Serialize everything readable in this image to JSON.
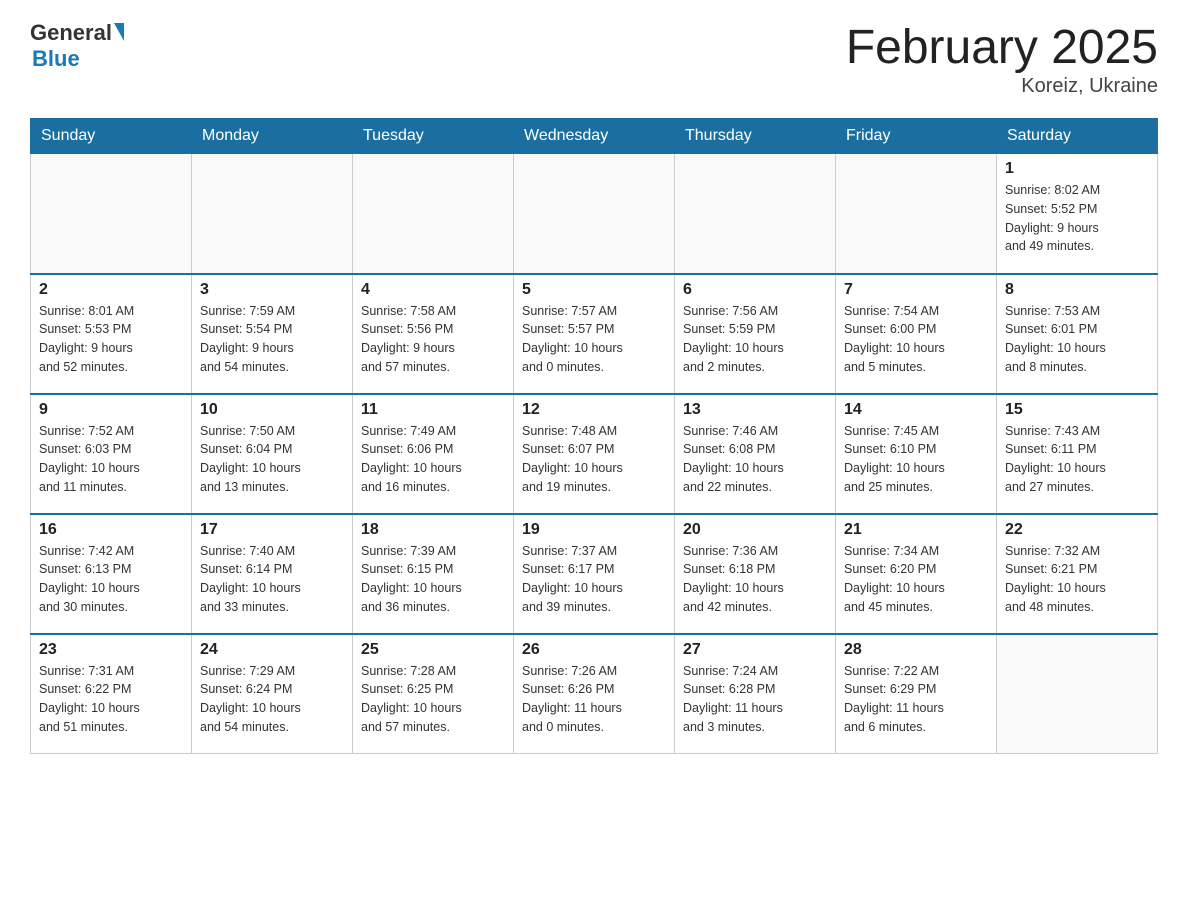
{
  "header": {
    "logo_general": "General",
    "logo_blue": "Blue",
    "title": "February 2025",
    "subtitle": "Koreiz, Ukraine"
  },
  "days_of_week": [
    "Sunday",
    "Monday",
    "Tuesday",
    "Wednesday",
    "Thursday",
    "Friday",
    "Saturday"
  ],
  "weeks": [
    [
      {
        "day": "",
        "info": ""
      },
      {
        "day": "",
        "info": ""
      },
      {
        "day": "",
        "info": ""
      },
      {
        "day": "",
        "info": ""
      },
      {
        "day": "",
        "info": ""
      },
      {
        "day": "",
        "info": ""
      },
      {
        "day": "1",
        "info": "Sunrise: 8:02 AM\nSunset: 5:52 PM\nDaylight: 9 hours\nand 49 minutes."
      }
    ],
    [
      {
        "day": "2",
        "info": "Sunrise: 8:01 AM\nSunset: 5:53 PM\nDaylight: 9 hours\nand 52 minutes."
      },
      {
        "day": "3",
        "info": "Sunrise: 7:59 AM\nSunset: 5:54 PM\nDaylight: 9 hours\nand 54 minutes."
      },
      {
        "day": "4",
        "info": "Sunrise: 7:58 AM\nSunset: 5:56 PM\nDaylight: 9 hours\nand 57 minutes."
      },
      {
        "day": "5",
        "info": "Sunrise: 7:57 AM\nSunset: 5:57 PM\nDaylight: 10 hours\nand 0 minutes."
      },
      {
        "day": "6",
        "info": "Sunrise: 7:56 AM\nSunset: 5:59 PM\nDaylight: 10 hours\nand 2 minutes."
      },
      {
        "day": "7",
        "info": "Sunrise: 7:54 AM\nSunset: 6:00 PM\nDaylight: 10 hours\nand 5 minutes."
      },
      {
        "day": "8",
        "info": "Sunrise: 7:53 AM\nSunset: 6:01 PM\nDaylight: 10 hours\nand 8 minutes."
      }
    ],
    [
      {
        "day": "9",
        "info": "Sunrise: 7:52 AM\nSunset: 6:03 PM\nDaylight: 10 hours\nand 11 minutes."
      },
      {
        "day": "10",
        "info": "Sunrise: 7:50 AM\nSunset: 6:04 PM\nDaylight: 10 hours\nand 13 minutes."
      },
      {
        "day": "11",
        "info": "Sunrise: 7:49 AM\nSunset: 6:06 PM\nDaylight: 10 hours\nand 16 minutes."
      },
      {
        "day": "12",
        "info": "Sunrise: 7:48 AM\nSunset: 6:07 PM\nDaylight: 10 hours\nand 19 minutes."
      },
      {
        "day": "13",
        "info": "Sunrise: 7:46 AM\nSunset: 6:08 PM\nDaylight: 10 hours\nand 22 minutes."
      },
      {
        "day": "14",
        "info": "Sunrise: 7:45 AM\nSunset: 6:10 PM\nDaylight: 10 hours\nand 25 minutes."
      },
      {
        "day": "15",
        "info": "Sunrise: 7:43 AM\nSunset: 6:11 PM\nDaylight: 10 hours\nand 27 minutes."
      }
    ],
    [
      {
        "day": "16",
        "info": "Sunrise: 7:42 AM\nSunset: 6:13 PM\nDaylight: 10 hours\nand 30 minutes."
      },
      {
        "day": "17",
        "info": "Sunrise: 7:40 AM\nSunset: 6:14 PM\nDaylight: 10 hours\nand 33 minutes."
      },
      {
        "day": "18",
        "info": "Sunrise: 7:39 AM\nSunset: 6:15 PM\nDaylight: 10 hours\nand 36 minutes."
      },
      {
        "day": "19",
        "info": "Sunrise: 7:37 AM\nSunset: 6:17 PM\nDaylight: 10 hours\nand 39 minutes."
      },
      {
        "day": "20",
        "info": "Sunrise: 7:36 AM\nSunset: 6:18 PM\nDaylight: 10 hours\nand 42 minutes."
      },
      {
        "day": "21",
        "info": "Sunrise: 7:34 AM\nSunset: 6:20 PM\nDaylight: 10 hours\nand 45 minutes."
      },
      {
        "day": "22",
        "info": "Sunrise: 7:32 AM\nSunset: 6:21 PM\nDaylight: 10 hours\nand 48 minutes."
      }
    ],
    [
      {
        "day": "23",
        "info": "Sunrise: 7:31 AM\nSunset: 6:22 PM\nDaylight: 10 hours\nand 51 minutes."
      },
      {
        "day": "24",
        "info": "Sunrise: 7:29 AM\nSunset: 6:24 PM\nDaylight: 10 hours\nand 54 minutes."
      },
      {
        "day": "25",
        "info": "Sunrise: 7:28 AM\nSunset: 6:25 PM\nDaylight: 10 hours\nand 57 minutes."
      },
      {
        "day": "26",
        "info": "Sunrise: 7:26 AM\nSunset: 6:26 PM\nDaylight: 11 hours\nand 0 minutes."
      },
      {
        "day": "27",
        "info": "Sunrise: 7:24 AM\nSunset: 6:28 PM\nDaylight: 11 hours\nand 3 minutes."
      },
      {
        "day": "28",
        "info": "Sunrise: 7:22 AM\nSunset: 6:29 PM\nDaylight: 11 hours\nand 6 minutes."
      },
      {
        "day": "",
        "info": ""
      }
    ]
  ]
}
